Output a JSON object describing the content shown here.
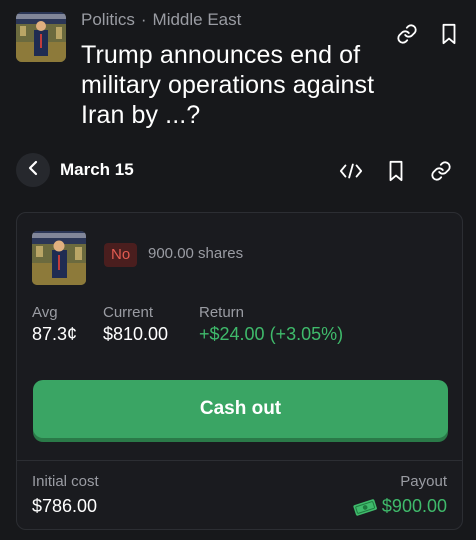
{
  "header": {
    "category": "Politics",
    "separator": "·",
    "subcategory": "Middle East",
    "title": "Trump announces end of military operations against Iran by ...?"
  },
  "date_row": {
    "date": "March 15"
  },
  "position": {
    "side": "No",
    "shares": "900.00 shares",
    "avg_label": "Avg",
    "avg_value": "87.3¢",
    "current_label": "Current",
    "current_value": "$810.00",
    "return_label": "Return",
    "return_value": "+$24.00 (+3.05%)",
    "cash_out_label": "Cash out",
    "initial_cost_label": "Initial cost",
    "initial_cost_value": "$786.00",
    "payout_label": "Payout",
    "payout_value": "$900.00"
  },
  "colors": {
    "background": "#17181b",
    "accent_green": "#3aa564",
    "positive_text": "#3fba6b",
    "no_badge_bg": "#4a1e1e",
    "no_badge_text": "#e25b51",
    "muted_text": "#9a9ca3"
  },
  "icons": {
    "header": [
      "link-icon",
      "bookmark-icon"
    ],
    "date_row": [
      "chevron-left-icon",
      "embed-code-icon",
      "bookmark-icon",
      "link-icon"
    ],
    "payout": "money-icon"
  }
}
